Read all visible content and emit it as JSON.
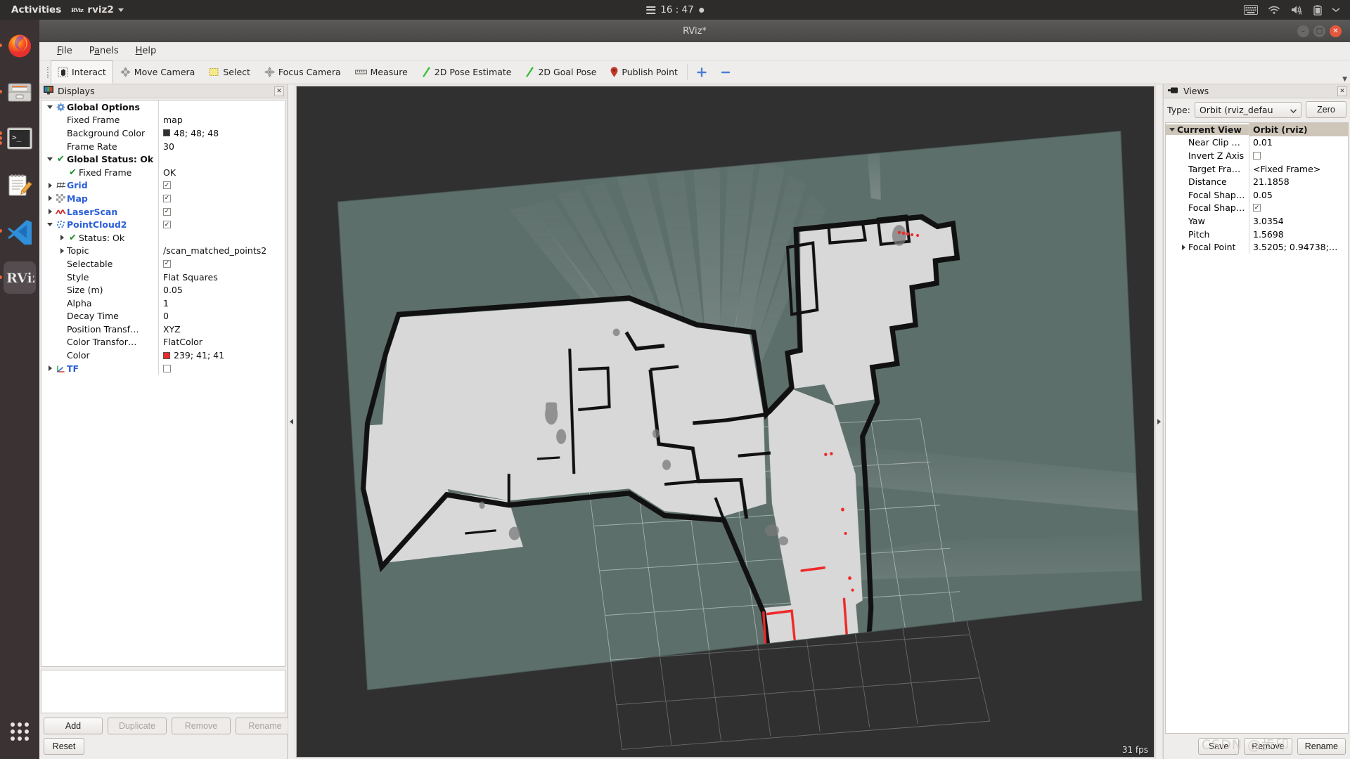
{
  "os_bar": {
    "activities": "Activities",
    "app_name": "rviz2",
    "app_logo_text": "RViz",
    "clock": "16 : 47",
    "tray_icons": [
      "keyboard-icon",
      "wifi-icon",
      "volume-muted-icon",
      "battery-icon",
      "chevron-down-icon"
    ]
  },
  "dock": {
    "items": [
      {
        "name": "firefox",
        "label": "Firefox"
      },
      {
        "name": "files",
        "label": "Files"
      },
      {
        "name": "terminal",
        "label": "Terminal"
      },
      {
        "name": "text-editor",
        "label": "Text Editor"
      },
      {
        "name": "vscode",
        "label": "Visual Studio Code"
      },
      {
        "name": "rviz",
        "label": "RViz"
      }
    ],
    "show_apps_label": "Show Applications"
  },
  "window": {
    "title": "RViz*",
    "buttons": {
      "minimize": "–",
      "maximize": "□",
      "close": "✕"
    }
  },
  "menubar": [
    {
      "label": "File",
      "mnemonic": "F"
    },
    {
      "label": "Panels",
      "mnemonic": "a"
    },
    {
      "label": "Help",
      "mnemonic": "H"
    }
  ],
  "toolbar": [
    {
      "label": "Interact",
      "icon": "hand-cursor-icon",
      "checked": true
    },
    {
      "label": "Move Camera",
      "icon": "move-camera-icon",
      "checked": false
    },
    {
      "label": "Select",
      "icon": "select-rect-icon",
      "checked": false
    },
    {
      "label": "Focus Camera",
      "icon": "focus-camera-icon",
      "checked": false
    },
    {
      "label": "Measure",
      "icon": "ruler-icon",
      "checked": false
    },
    {
      "label": "2D Pose Estimate",
      "icon": "green-arrow-icon",
      "checked": false
    },
    {
      "label": "2D Goal Pose",
      "icon": "green-arrow-icon",
      "checked": false
    },
    {
      "label": "Publish Point",
      "icon": "map-pin-icon",
      "checked": false
    },
    {
      "label": "",
      "icon": "plus-icon",
      "checked": false
    },
    {
      "label": "",
      "icon": "minus-icon",
      "checked": false
    }
  ],
  "displays": {
    "panel_title": "Displays",
    "panel_icon": "monitor-icon",
    "close_label": "✕",
    "rows": [
      {
        "indent": 0,
        "arrow": "expanded",
        "icon": "gear-icon",
        "name": "Global Options",
        "style": "sect",
        "value": "",
        "value_type": "text"
      },
      {
        "indent": 1,
        "arrow": "none",
        "icon": "none",
        "name": "Fixed Frame",
        "style": "plain",
        "value": "map",
        "value_type": "text"
      },
      {
        "indent": 1,
        "arrow": "none",
        "icon": "none",
        "name": "Background Color",
        "style": "plain",
        "value": "48; 48; 48",
        "value_type": "color",
        "swatch": "#303030"
      },
      {
        "indent": 1,
        "arrow": "none",
        "icon": "none",
        "name": "Frame Rate",
        "style": "plain",
        "value": "30",
        "value_type": "text"
      },
      {
        "indent": 0,
        "arrow": "expanded",
        "icon": "check-green-icon",
        "name": "Global Status: Ok",
        "style": "sect",
        "value": "",
        "value_type": "text"
      },
      {
        "indent": 1,
        "arrow": "none",
        "icon": "check-green-icon",
        "name": "Fixed Frame",
        "style": "plain",
        "value": "OK",
        "value_type": "text"
      },
      {
        "indent": 0,
        "arrow": "collapsed",
        "icon": "grid-icon",
        "name": "Grid",
        "style": "disp",
        "value": "✓",
        "value_type": "checkbox",
        "checked": true
      },
      {
        "indent": 0,
        "arrow": "collapsed",
        "icon": "map-icon",
        "name": "Map",
        "style": "disp",
        "value": "✓",
        "value_type": "checkbox",
        "checked": true
      },
      {
        "indent": 0,
        "arrow": "collapsed",
        "icon": "laserscan-icon",
        "name": "LaserScan",
        "style": "disp",
        "value": "✓",
        "value_type": "checkbox",
        "checked": true
      },
      {
        "indent": 0,
        "arrow": "expanded",
        "icon": "pointcloud-icon",
        "name": "PointCloud2",
        "style": "disp",
        "value": "✓",
        "value_type": "checkbox",
        "checked": true
      },
      {
        "indent": 1,
        "arrow": "collapsed",
        "icon": "check-green-icon",
        "name": "Status: Ok",
        "style": "plain",
        "value": "",
        "value_type": "text"
      },
      {
        "indent": 1,
        "arrow": "collapsed",
        "icon": "none",
        "name": "Topic",
        "style": "plain",
        "value": "/scan_matched_points2",
        "value_type": "text"
      },
      {
        "indent": 1,
        "arrow": "none",
        "icon": "none",
        "name": "Selectable",
        "style": "plain",
        "value": "✓",
        "value_type": "checkbox",
        "checked": true
      },
      {
        "indent": 1,
        "arrow": "none",
        "icon": "none",
        "name": "Style",
        "style": "plain",
        "value": "Flat Squares",
        "value_type": "text"
      },
      {
        "indent": 1,
        "arrow": "none",
        "icon": "none",
        "name": "Size (m)",
        "style": "plain",
        "value": "0.05",
        "value_type": "text"
      },
      {
        "indent": 1,
        "arrow": "none",
        "icon": "none",
        "name": "Alpha",
        "style": "plain",
        "value": "1",
        "value_type": "text"
      },
      {
        "indent": 1,
        "arrow": "none",
        "icon": "none",
        "name": "Decay Time",
        "style": "plain",
        "value": "0",
        "value_type": "text"
      },
      {
        "indent": 1,
        "arrow": "none",
        "icon": "none",
        "name": "Position Transf…",
        "style": "plain",
        "value": "XYZ",
        "value_type": "text"
      },
      {
        "indent": 1,
        "arrow": "none",
        "icon": "none",
        "name": "Color Transfor…",
        "style": "plain",
        "value": "FlatColor",
        "value_type": "text"
      },
      {
        "indent": 1,
        "arrow": "none",
        "icon": "none",
        "name": "Color",
        "style": "plain",
        "value": "239; 41; 41",
        "value_type": "color",
        "swatch": "#ef2929"
      },
      {
        "indent": 0,
        "arrow": "collapsed",
        "icon": "tf-icon",
        "name": "TF",
        "style": "disp",
        "value": "",
        "value_type": "checkbox",
        "checked": false
      }
    ],
    "buttons": [
      {
        "label": "Add",
        "enabled": true
      },
      {
        "label": "Duplicate",
        "enabled": false
      },
      {
        "label": "Remove",
        "enabled": false
      },
      {
        "label": "Rename",
        "enabled": false
      }
    ],
    "reset_label": "Reset"
  },
  "views": {
    "panel_title": "Views",
    "panel_icon": "camera-icon",
    "close_label": "✕",
    "type_label": "Type:",
    "type_value": "Orbit (rviz_defau",
    "zero_label": "Zero",
    "header": {
      "name": "Current View",
      "value": "Orbit (rviz)"
    },
    "rows": [
      {
        "indent": 1,
        "arrow": "none",
        "name": "Near Clip …",
        "value": "0.01",
        "value_type": "text"
      },
      {
        "indent": 1,
        "arrow": "none",
        "name": "Invert Z Axis",
        "value": "",
        "value_type": "checkbox",
        "checked": false
      },
      {
        "indent": 1,
        "arrow": "none",
        "name": "Target Fra…",
        "value": "<Fixed Frame>",
        "value_type": "text"
      },
      {
        "indent": 1,
        "arrow": "none",
        "name": "Distance",
        "value": "21.1858",
        "value_type": "text"
      },
      {
        "indent": 1,
        "arrow": "none",
        "name": "Focal Shap…",
        "value": "0.05",
        "value_type": "text"
      },
      {
        "indent": 1,
        "arrow": "none",
        "name": "Focal Shap…",
        "value": "✓",
        "value_type": "checkbox",
        "checked": true
      },
      {
        "indent": 1,
        "arrow": "none",
        "name": "Yaw",
        "value": "3.0354",
        "value_type": "text"
      },
      {
        "indent": 1,
        "arrow": "none",
        "name": "Pitch",
        "value": "1.5698",
        "value_type": "text"
      },
      {
        "indent": 1,
        "arrow": "collapsed",
        "name": "Focal Point",
        "value": "3.5205; 0.94738;…",
        "value_type": "text"
      }
    ],
    "buttons": [
      {
        "label": "Save",
        "enabled": true
      },
      {
        "label": "Remove",
        "enabled": true
      },
      {
        "label": "Rename",
        "enabled": true
      }
    ]
  },
  "viewport": {
    "fps": "31 fps",
    "background_color": "#303030",
    "map_plane_color": "#5d6f6b",
    "occupied_color": "#121212",
    "free_color": "#d8d8d8",
    "pointcloud_color": "#ef2929",
    "grid_color": "#c8d2cf"
  },
  "watermark": "CSDN @步印"
}
